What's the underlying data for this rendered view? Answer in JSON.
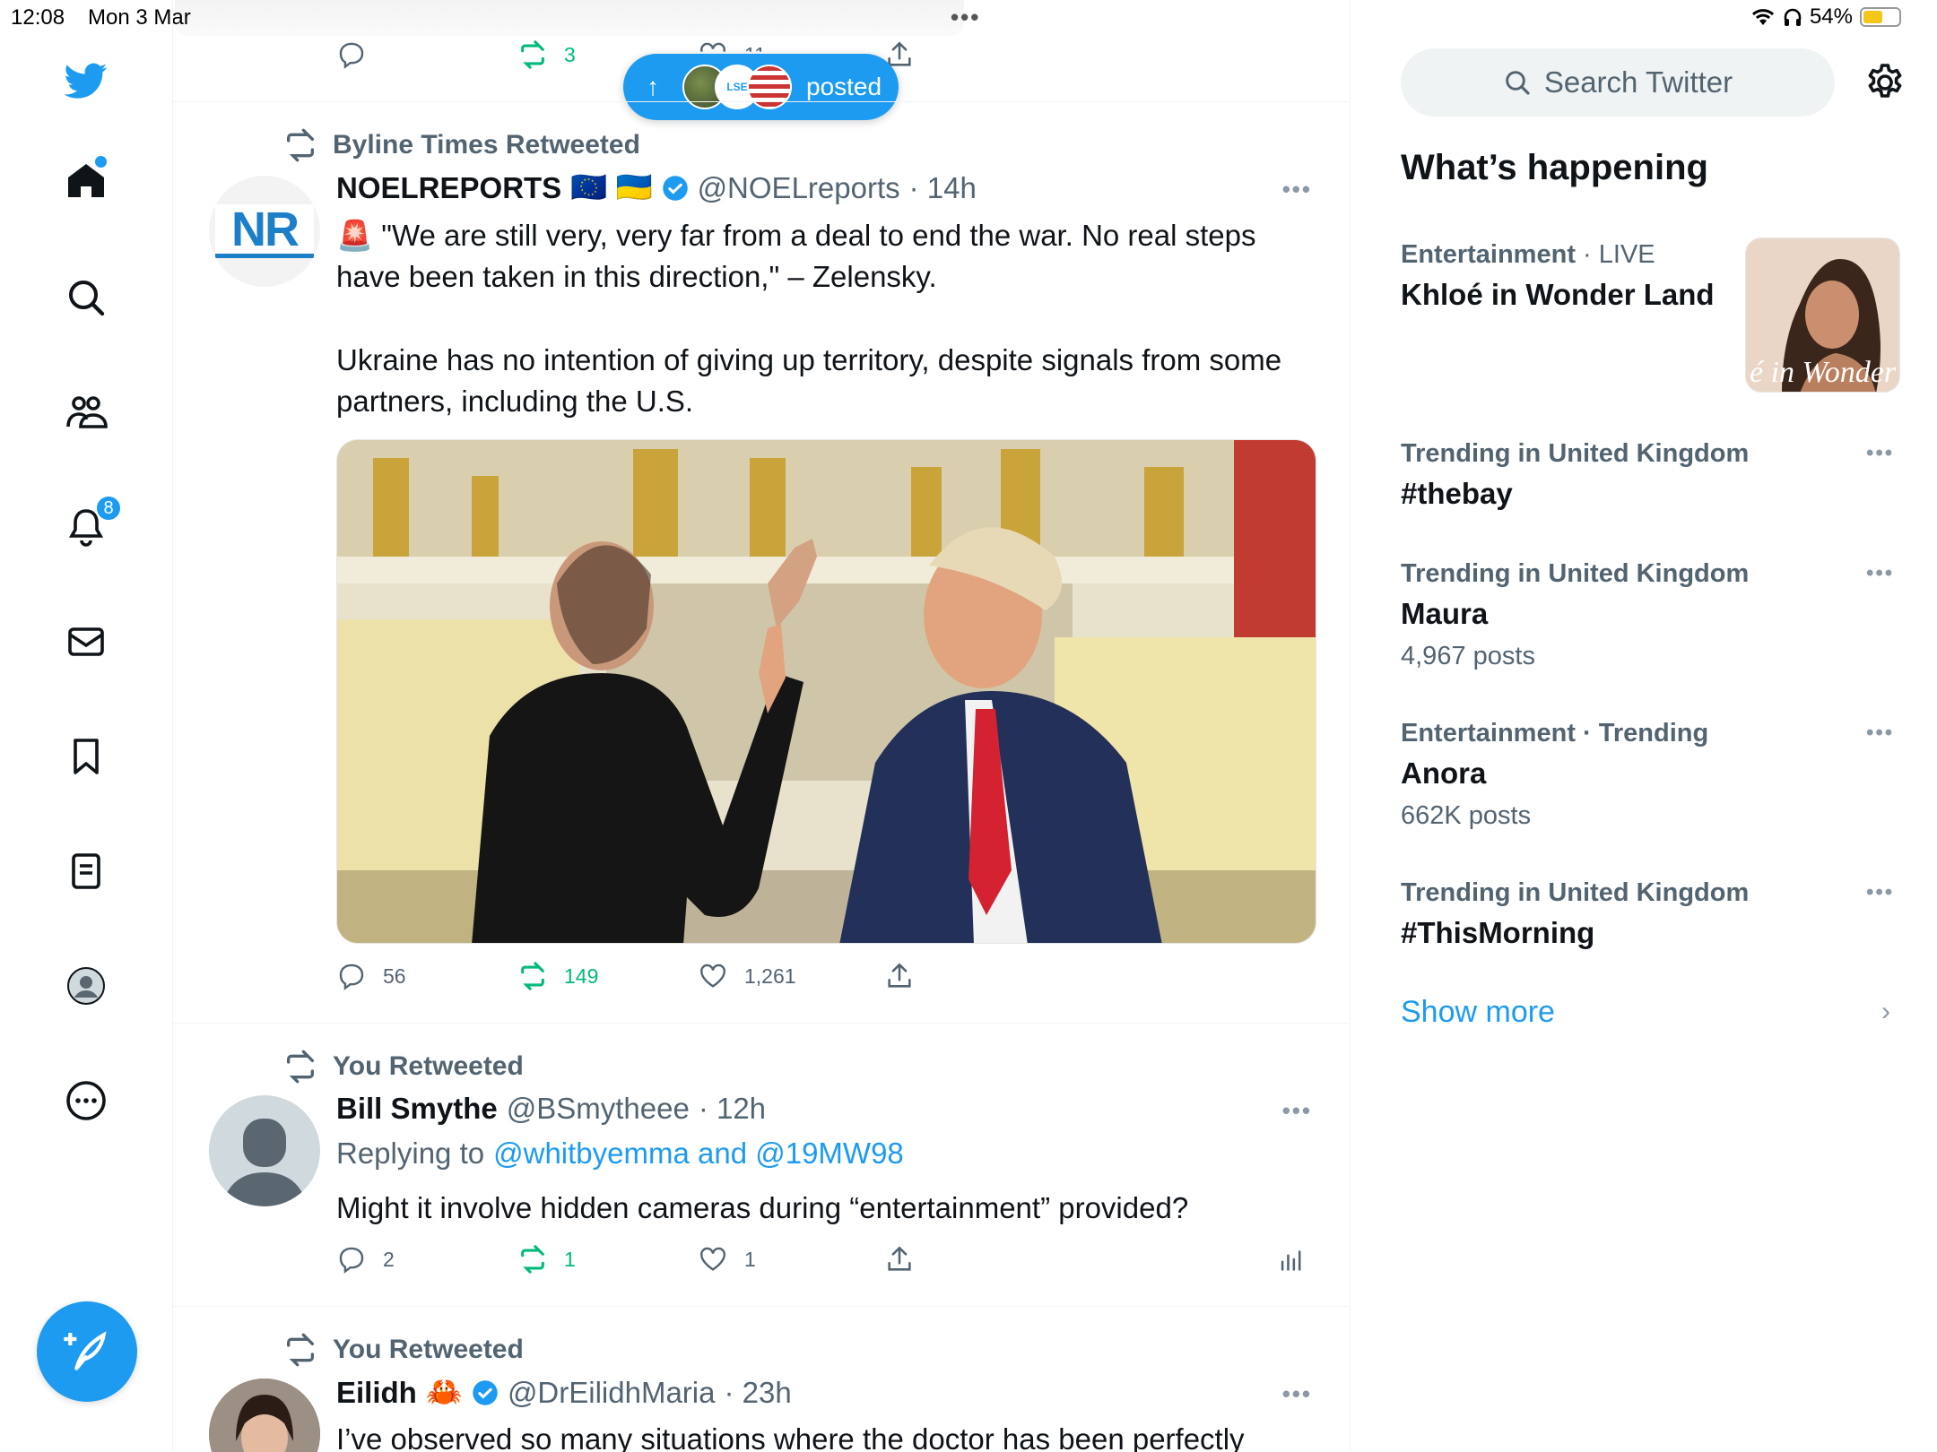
{
  "status_bar": {
    "time": "12:08",
    "date": "Mon 3 Mar",
    "battery": "54%",
    "battery_level": 0.54,
    "top_dots": "•••"
  },
  "nav": {
    "notifications_badge": "8",
    "items": [
      "twitter-logo",
      "home-icon",
      "search-icon",
      "communities-icon",
      "notifications-icon",
      "messages-icon",
      "bookmarks-icon",
      "lists-icon",
      "profile-icon",
      "more-icon"
    ]
  },
  "posted_pill": {
    "label": "posted",
    "arrow": "↑"
  },
  "prev_tweet": {
    "retweets": "3",
    "likes": "11"
  },
  "tweets": [
    {
      "retweeted_by": "Byline Times Retweeted",
      "name": "NOELREPORTS",
      "flags": "🇪🇺 🇺🇦",
      "handle": "@NOELreports",
      "time": "· 14h",
      "emoji": "🚨",
      "text1": "\"We are still very, very far from a deal to end the war. No real steps have been taken in this direction,\" – Zelensky.",
      "text2": "Ukraine has no intention of giving up territory, despite signals from some partners, including the U.S.",
      "replies": "56",
      "retweets": "149",
      "likes": "1,261",
      "avatar_text": "NR"
    },
    {
      "retweeted_by": "You Retweeted",
      "name": "Bill Smythe",
      "handle": "@BSmytheee",
      "time": "· 12h",
      "replying_prefix": "Replying to",
      "replying_to": "@whitbyemma and @19MW98",
      "text": "Might it involve hidden cameras during “entertainment” provided?",
      "replies": "2",
      "retweets": "1",
      "likes": "1"
    },
    {
      "retweeted_by": "You Retweeted",
      "name": "Eilidh",
      "emoji": "🦀",
      "handle": "@DrEilidhMaria",
      "time": "· 23h",
      "text": "I’ve observed so many situations where the doctor has been perfectly"
    }
  ],
  "right": {
    "search_placeholder": "Search Twitter",
    "section_title": "What’s happening",
    "trends": [
      {
        "meta": "Entertainment",
        "meta_suffix": "· LIVE",
        "title": "Khloé in Wonder Land",
        "image_caption": "é in Wonder L"
      },
      {
        "meta": "Trending in United Kingdom",
        "title": "#thebay"
      },
      {
        "meta": "Trending in United Kingdom",
        "title": "Maura",
        "count": "4,967 posts"
      },
      {
        "meta": "Entertainment · Trending",
        "title": "Anora",
        "count": "662K posts"
      },
      {
        "meta": "Trending in United Kingdom",
        "title": "#ThisMorning"
      }
    ],
    "show_more": "Show more"
  },
  "colors": {
    "accent": "#1d9bf0",
    "retweet_green": "#00ba7c",
    "secondary_text": "#536471"
  }
}
